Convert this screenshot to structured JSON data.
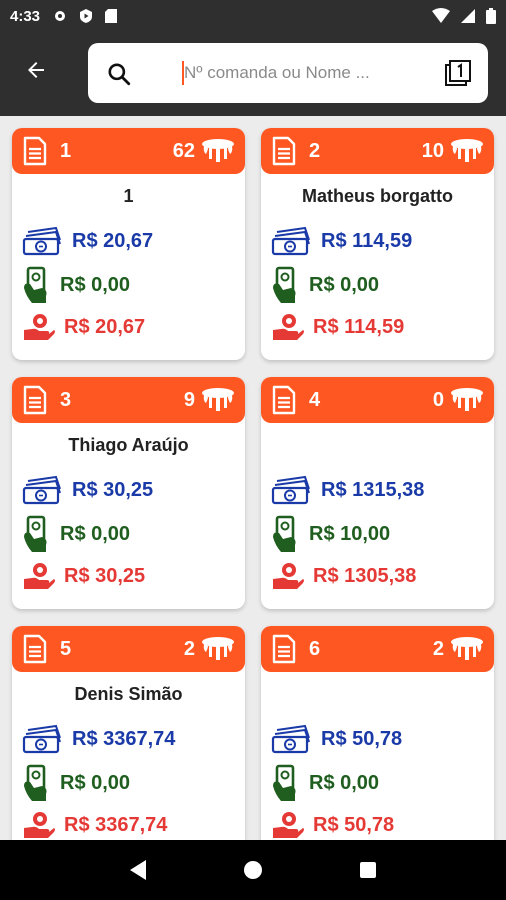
{
  "status_bar": {
    "time": "4:33"
  },
  "search": {
    "placeholder": "Nº comanda ou Nome ..."
  },
  "colors": {
    "accent": "#ff5722",
    "total": "#1a3aa8",
    "paid": "#1f5e1f",
    "rest": "#e53935"
  },
  "cards": [
    {
      "number": "1",
      "count": "62",
      "name": "1",
      "total": "R$ 20,67",
      "paid": "R$ 0,00",
      "rest": "R$ 20,67"
    },
    {
      "number": "2",
      "count": "10",
      "name": "Matheus borgatto",
      "total": "R$ 114,59",
      "paid": "R$ 0,00",
      "rest": "R$ 114,59"
    },
    {
      "number": "3",
      "count": "9",
      "name": "Thiago Araújo",
      "total": "R$ 30,25",
      "paid": "R$ 0,00",
      "rest": "R$ 30,25"
    },
    {
      "number": "4",
      "count": "0",
      "name": "",
      "total": "R$ 1315,38",
      "paid": "R$ 10,00",
      "rest": "R$ 1305,38"
    },
    {
      "number": "5",
      "count": "2",
      "name": "Denis Simão",
      "total": "R$ 3367,74",
      "paid": "R$ 0,00",
      "rest": "R$ 3367,74"
    },
    {
      "number": "6",
      "count": "2",
      "name": "",
      "total": "R$ 50,78",
      "paid": "R$ 0,00",
      "rest": "R$ 50,78"
    }
  ]
}
